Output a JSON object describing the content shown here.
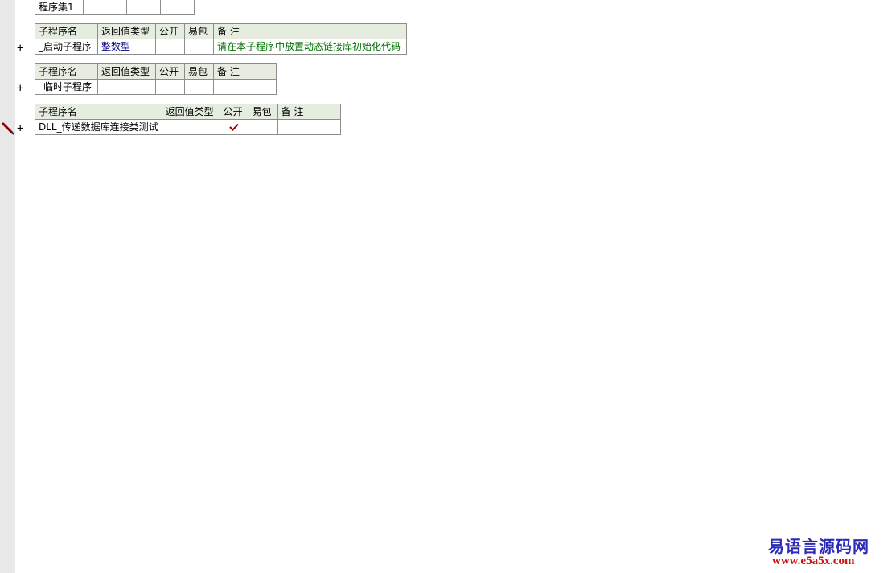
{
  "assembly": {
    "name": "程序集1"
  },
  "sub_header": {
    "name": "子程序名",
    "return_type": "返回值类型",
    "public": "公开",
    "easy_pack": "易包",
    "remark": "备 注"
  },
  "subroutines": [
    {
      "name": "_启动子程序",
      "return_type": "整数型",
      "public": "",
      "easy_pack": "",
      "remark": "请在本子程序中放置动态链接库初始化代码"
    },
    {
      "name": "_临时子程序",
      "return_type": "",
      "public": "",
      "easy_pack": "",
      "remark": ""
    },
    {
      "name": "DLL_传递数据库连接类测试",
      "return_type": "",
      "public_checked": true,
      "easy_pack": "",
      "remark": ""
    }
  ],
  "gutter": {
    "expand_symbol": "+",
    "edit_icon": "pencil-icon"
  },
  "watermark": {
    "title": "易语言源码网",
    "url": "www.e5a5x.com"
  },
  "colors": {
    "header_bg": "#e6ecdf",
    "type_text": "#000080",
    "remark_text": "#007000",
    "check": "#8b0000",
    "watermark_title": "#2b2bb8",
    "watermark_url": "#cc1010"
  }
}
